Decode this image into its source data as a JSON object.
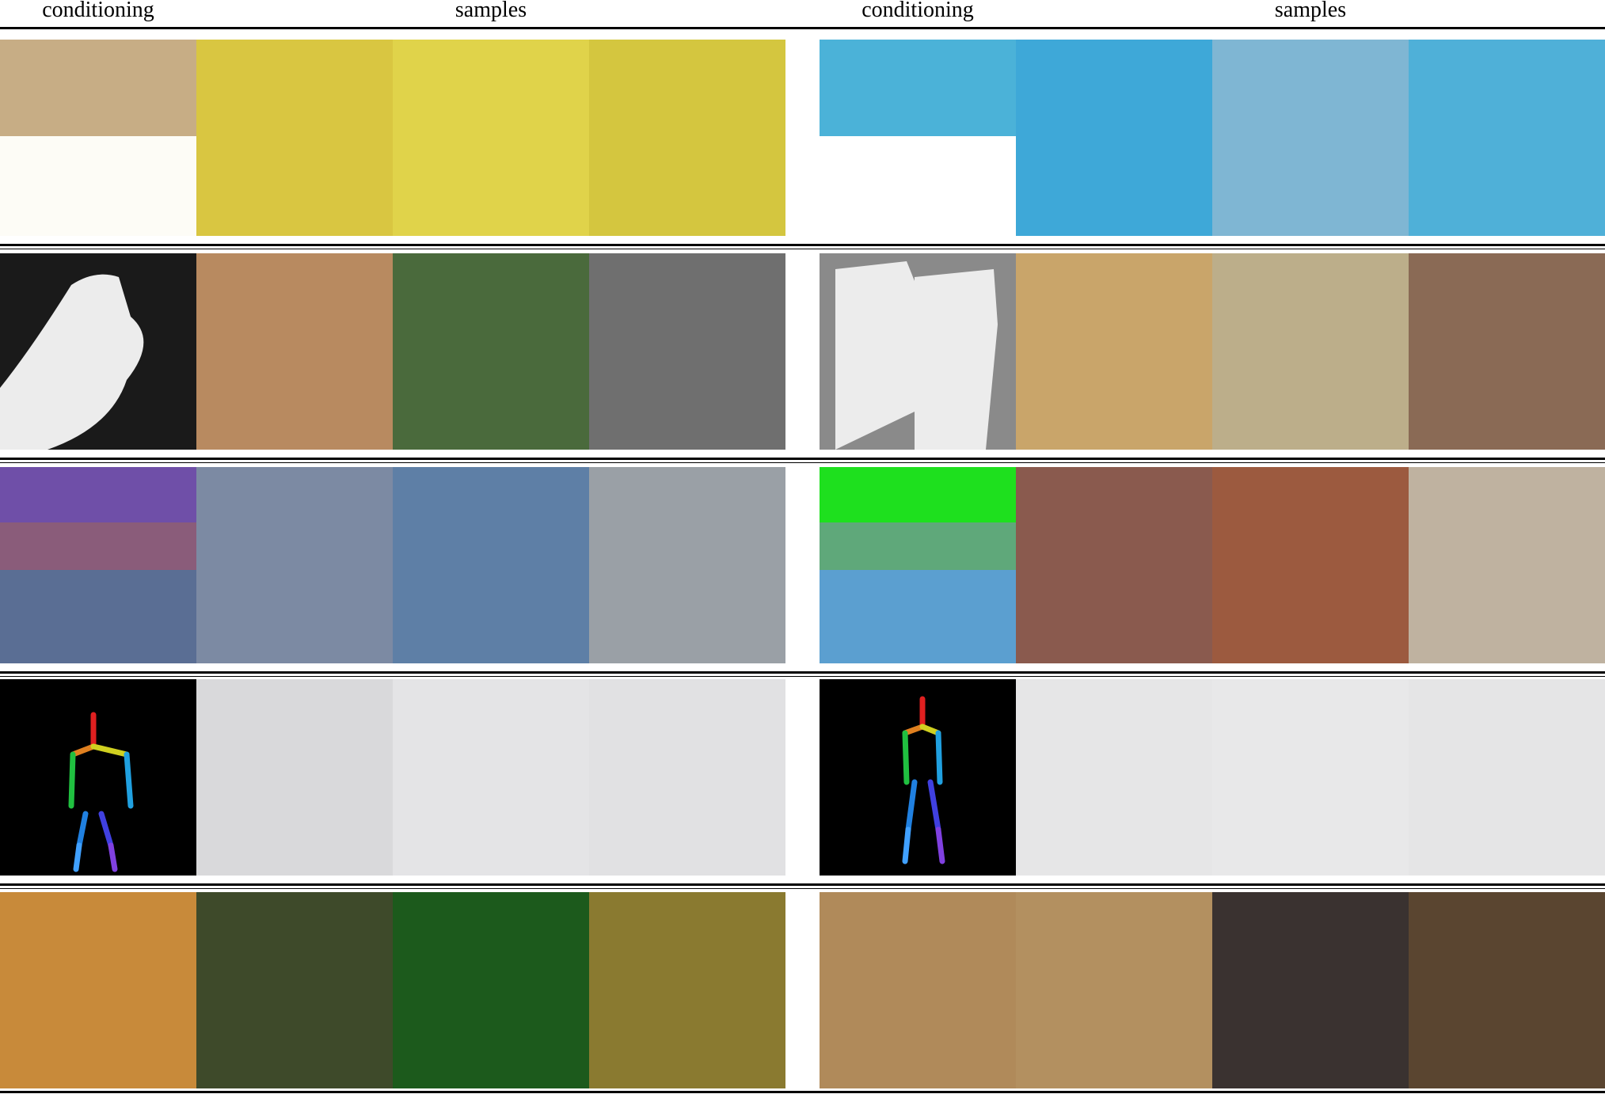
{
  "headers": {
    "left_conditioning": "conditioning",
    "left_samples": "samples",
    "right_conditioning": "conditioning",
    "right_samples": "samples"
  },
  "rows": [
    {
      "name": "row-inpainting",
      "left": [
        "seal-conditioning-masked",
        "seal-sample-1",
        "seal-sample-2",
        "seal-sample-3"
      ],
      "right": [
        "tower-conditioning-masked",
        "tower-sample-1",
        "tower-sample-2",
        "tower-sample-3"
      ]
    },
    {
      "name": "row-depth",
      "left": [
        "bird-depth-map",
        "bird-sample-1",
        "bird-sample-2",
        "bird-sample-3"
      ],
      "right": [
        "dogs-depth-map",
        "dogs-sample-1",
        "dogs-sample-2",
        "dogs-sample-3"
      ]
    },
    {
      "name": "row-segmentation",
      "left": [
        "beach-segmentation-map",
        "beach-sample-1",
        "beach-sample-2",
        "beach-sample-3"
      ],
      "right": [
        "kitchen-segmentation-map",
        "kitchen-sample-1",
        "kitchen-sample-2",
        "kitchen-sample-3"
      ]
    },
    {
      "name": "row-pose",
      "left": [
        "pose-skeleton-a",
        "woman-sample-1",
        "woman-sample-2",
        "woman-sample-3"
      ],
      "right": [
        "pose-skeleton-b",
        "model-sample-1",
        "model-sample-2",
        "model-sample-3"
      ]
    },
    {
      "name": "row-class",
      "left": [
        "frog-conditioning",
        "frog-sample-1",
        "frog-sample-2",
        "frog-sample-3"
      ],
      "right": [
        "mastiff-conditioning",
        "mastiff-sample-1",
        "mastiff-sample-2",
        "mastiff-sample-3"
      ]
    }
  ],
  "colors": {
    "seal": [
      "#c7ad85",
      "#d9c641",
      "#e0d34a",
      "#d4c63f"
    ],
    "tower": [
      "#4bb2d8",
      "#3ea8d8",
      "#7fb6d3",
      "#4fb0d8"
    ],
    "bird": [
      "#9a9a9a",
      "#b88a60",
      "#4a6a3c",
      "#6f6f6f"
    ],
    "dogs": [
      "#bdbdbd",
      "#c9a56a",
      "#bcae8a",
      "#8a6a55"
    ],
    "beach": [
      "#8a5c7a",
      "#7c8aa3",
      "#5e7fa6",
      "#9aa0a6"
    ],
    "kitchen": [
      "#5fa87a",
      "#8a5a4e",
      "#9c5a3f",
      "#bfb2a0"
    ],
    "pose_left": [
      "#000000",
      "#d9d9db",
      "#e4e4e6",
      "#e1e1e3"
    ],
    "pose_right": [
      "#000000",
      "#e6e6e7",
      "#e8e8e9",
      "#e5e5e6"
    ],
    "frog": [
      "#c88a3a",
      "#3e4a2a",
      "#1c5a1c",
      "#8a7a30"
    ],
    "mastiff": [
      "#b08a5a",
      "#b39060",
      "#3a3230",
      "#5a4530"
    ]
  }
}
